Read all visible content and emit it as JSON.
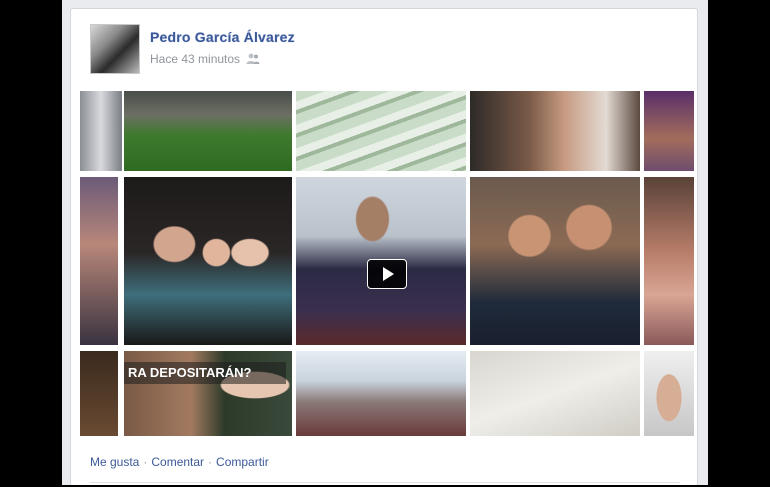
{
  "post": {
    "author": "Pedro García Álvarez",
    "timestamp": "Hace 43 minutos",
    "audience_icon": "friends-icon"
  },
  "media": {
    "overlay_text": "RA DEPOSITARÁN?",
    "play_icon": "play-icon"
  },
  "actions": {
    "like": "Me gusta",
    "comment": "Comentar",
    "share": "Compartir",
    "separator": "·"
  },
  "colors": {
    "link": "#3b5998",
    "meta": "#90949c",
    "background": "#e9ebee"
  }
}
